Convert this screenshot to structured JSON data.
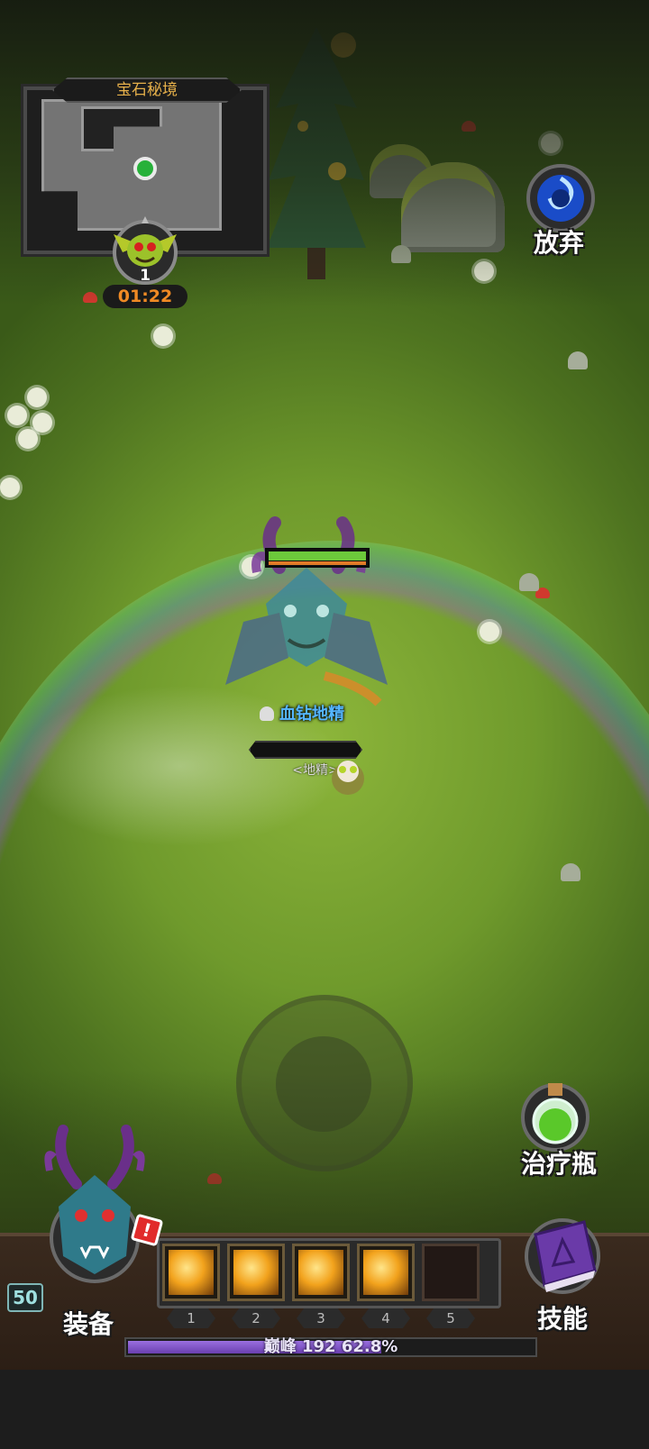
{
  "minimap": {
    "title": "宝石秘境"
  },
  "boss_badge": {
    "level": "1",
    "timer": "01:22"
  },
  "quit_button": {
    "label": "放弃"
  },
  "boss": {
    "hp_fraction": 1.0
  },
  "enemy": {
    "name": "血钻地精",
    "tag": "<地精>",
    "hp_fraction": 0.0
  },
  "potion_button": {
    "label": "治疗瓶"
  },
  "equipment": {
    "label": "装备",
    "level": "50",
    "alert": "!"
  },
  "skills_button": {
    "label": "技能"
  },
  "skill_slots": [
    {
      "number": "1",
      "filled": true
    },
    {
      "number": "2",
      "filled": true
    },
    {
      "number": "3",
      "filled": true
    },
    {
      "number": "4",
      "filled": true
    },
    {
      "number": "5",
      "filled": false
    }
  ],
  "experience": {
    "text": "巅峰 192 62.8%",
    "fraction": 0.628
  },
  "colors": {
    "timer": "#f08a24",
    "enemy_name": "#55b6ff",
    "minimap_title": "#e6b04a",
    "xp_fill": "#7a4fd0"
  }
}
